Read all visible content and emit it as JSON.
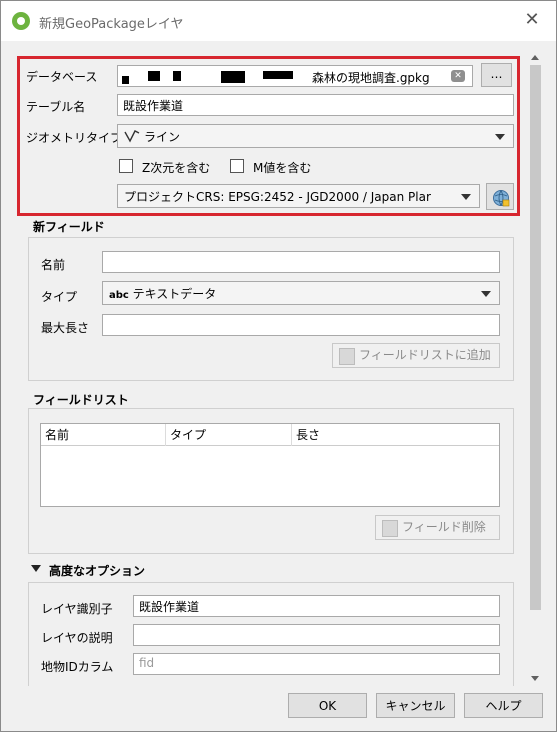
{
  "window": {
    "title": "新規GeoPackageレイヤ"
  },
  "database": {
    "label": "データベース",
    "value_suffix": "森林の現地調査.gpkg",
    "browse_label": "…"
  },
  "table_name": {
    "label": "テーブル名",
    "value": "既設作業道"
  },
  "geometry_type": {
    "label": "ジオメトリタイプ",
    "value": "ライン"
  },
  "options": {
    "z_label": "Z次元を含む",
    "m_label": "M値を含む"
  },
  "crs": {
    "value": "プロジェクトCRS: EPSG:2452 - JGD2000 / Japan Plar"
  },
  "new_field": {
    "title": "新フィールド",
    "name_label": "名前",
    "type_label": "タイプ",
    "type_prefix": "abc",
    "type_value": "テキストデータ",
    "maxlen_label": "最大長さ",
    "add_button": "フィールドリストに追加"
  },
  "field_list": {
    "title": "フィールドリスト",
    "columns": [
      "名前",
      "タイプ",
      "長さ"
    ],
    "delete_button": "フィールド削除"
  },
  "advanced": {
    "title": "高度なオプション",
    "layer_id_label": "レイヤ識別子",
    "layer_id_value": "既設作業道",
    "layer_desc_label": "レイヤの説明",
    "layer_desc_value": "",
    "fid_label": "地物IDカラム",
    "fid_placeholder": "fid"
  },
  "buttons": {
    "ok": "OK",
    "cancel": "キャンセル",
    "help": "ヘルプ"
  },
  "colors": {
    "highlight": "#d7262f",
    "qgis_green": "#6db33f"
  }
}
